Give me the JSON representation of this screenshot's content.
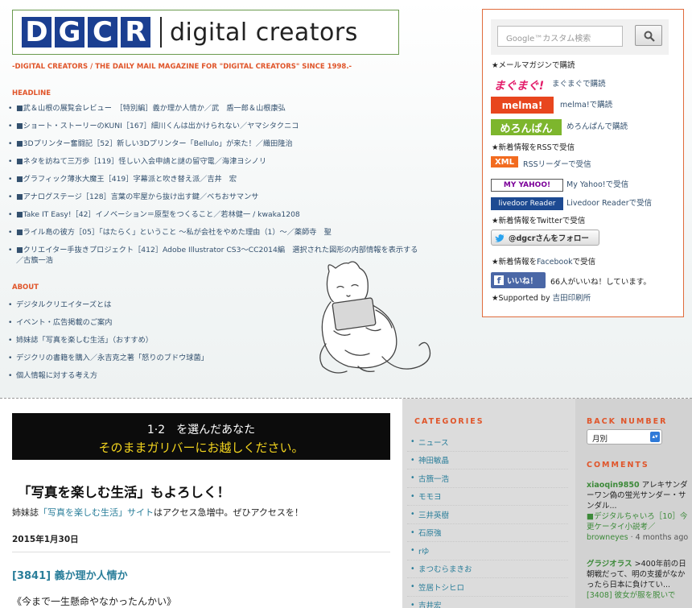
{
  "logo": {
    "letters": [
      "D",
      "G",
      "C",
      "R"
    ],
    "word": "digital creators"
  },
  "tagline": "-DIGITAL CREATORS / THE DAILY MAIL MAGAZINE FOR \"DIGITAL CREATORS\" SINCE 1998.-",
  "headline": {
    "title": "HEADLINE",
    "items": [
      "■武＆山根の展覧会レビュー　［特別編］義か理か人情か／武　盾一郎＆山根康弘",
      "■ショート・ストーリーのKUNI［167］細川くんは出かけられない／ヤマシタクニコ",
      "■3Dプリンター奮闘記［52］新しい3Dプリンター「Bellulo」が来た！／織田隆治",
      "■ネタを訪ねて三万歩［119］怪しい入会申請と謎の留守電／海津ヨシノリ",
      "■グラフィック薄氷大魔王［419］字幕派と吹き替え派／吉井　宏",
      "■アナログステージ［128］言葉の牢屋から抜け出す鍵／べちおサマンサ",
      "■Take IT Easy!［42］イノベーション＝原型をつくること／若林健一 / kwaka1208",
      "■ライル島の彼方［05］「はたらく」ということ 〜私が会社をやめた理由（1）〜／薬師寺　聖",
      "■クリエイター手抜きプロジェクト［412］Adobe Illustrator CS3〜CC2014編　選択された図形の内部情報を表示する／古籏一浩"
    ]
  },
  "about": {
    "title": "ABOUT",
    "items": [
      "デジタルクリエイターズとは",
      "イベント・広告掲載のご案内",
      "姉妹誌「写真を楽しむ生活」（おすすめ）",
      "デジクリの書籍を購入／永吉克之著「怒りのブドウ球菌」",
      "個人情報に対する考え方"
    ]
  },
  "sidebar": {
    "search_placeholder": "Google™カスタム検索",
    "mail_title": "★メールマガジンで購読",
    "mag2_badge": "まぐまぐ!",
    "mag2_link": "まぐまぐで購読",
    "melma_badge": "melma!",
    "melma_link": "melma!で購読",
    "mero_badge": "めろんぱん",
    "mero_link": "めろんぱんで購読",
    "rss_title": "★新着情報をRSSで受信",
    "xml_badge": "XML",
    "rss_link": "RSSリーダーで受信",
    "yahoo_badge": "MY YAHOO!",
    "yahoo_link": "My Yahoo!で受信",
    "livedoor_badge": "livedoor Reader",
    "livedoor_link": "Livedoor Readerで受信",
    "twitter_title": "★新着情報をTwitterで受信",
    "twitter_btn": "@dgcrさんをフォロー",
    "facebook_title_pre": "★新着情報を",
    "facebook_title_link": "Facebook",
    "facebook_title_post": "で受信",
    "like_btn": "いいね！",
    "like_count": "66人がいいね！しています。",
    "supported_pre": "★Supported by ",
    "supported_link": "吉田印刷所"
  },
  "banner": {
    "line1": "1·2　を選んだあなた",
    "line2": "そのままガリバーにお越しください。"
  },
  "promo": {
    "title": "「写真を楽しむ生活」もよろしく！",
    "text_pre": "姉妹誌",
    "text_link": "「写真を楽しむ生活」サイト",
    "text_post": "はアクセス急増中。ぜひアクセスを！"
  },
  "post": {
    "date": "2015年1月30日",
    "title": "[3841] 義か理か人情か",
    "quote": "《今まで一生懸命やなかったんかい》"
  },
  "categories": {
    "title": "CATEGORIES",
    "items": [
      "ニュース",
      "神田敏晶",
      "古籏一浩",
      "モモヨ",
      "三井英樹",
      "石原強",
      "rゆ",
      "まつむらまきお",
      "笠居トシヒロ",
      "吉井宏"
    ]
  },
  "back_number": {
    "title": "BACK NUMBER",
    "selected": "月別"
  },
  "comments": {
    "title": "COMMENTS",
    "c1_name": "xiaoqin9850",
    "c1_text": " アレキサンダーワン偽の蛍光サンダー・サンダル...",
    "c1_link": "■デジタルちゃいろ［10］今更ケータイ小説考／browneyes",
    "c1_time": " · 4 months ago",
    "c2_name": "グラジオラス",
    "c2_text": " >400年前の日朝戦だって、明の支援がなかったら日本に負けてい...",
    "c2_link": "[3408] 彼女が服を脱いで"
  },
  "colors": {
    "accent": "#e0552a",
    "logo_blue": "#1b3f91",
    "link": "#2a7e9a"
  }
}
